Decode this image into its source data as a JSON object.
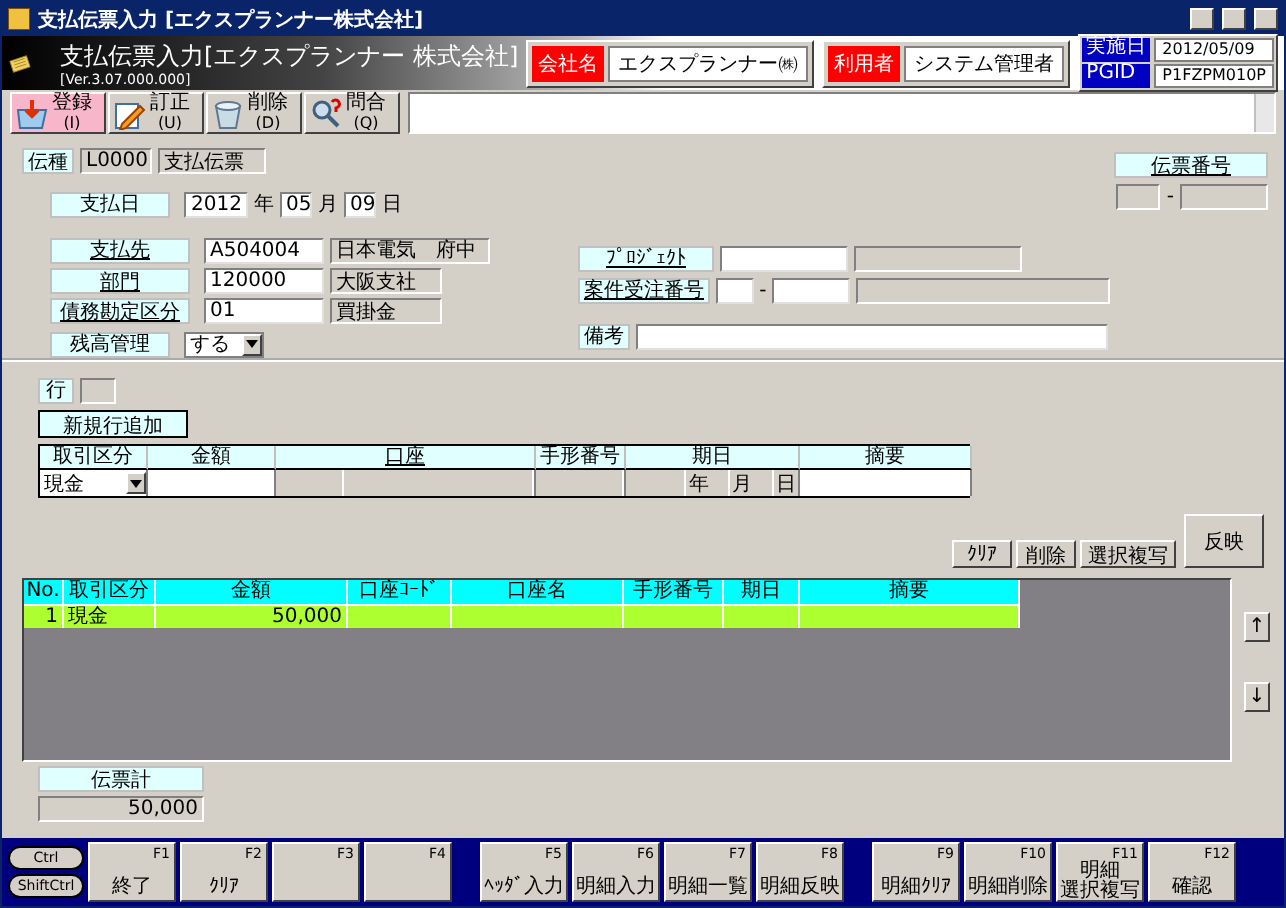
{
  "window": {
    "title": "支払伝票入力 [エクスプランナー株式会社]"
  },
  "header": {
    "title": "支払伝票入力[エクスプランナー 株式会社]",
    "version": "[Ver.3.07.000.000]",
    "company_label": "会社名",
    "company": "エクスプランナー㈱",
    "user_label": "利用者",
    "user": "システム管理者",
    "date_label": "実施日",
    "date": "2012/05/09",
    "pgid_label": "PGID",
    "pgid": "P1FZPM010P"
  },
  "toolbar": [
    {
      "kind": "register",
      "label": "登録",
      "key": "(I)",
      "selected": true
    },
    {
      "kind": "edit",
      "label": "訂正",
      "key": "(U)",
      "selected": false
    },
    {
      "kind": "delete",
      "label": "削除",
      "key": "(D)",
      "selected": false
    },
    {
      "kind": "inquiry",
      "label": "問合",
      "key": "(Q)",
      "selected": false
    }
  ],
  "form": {
    "slip_type": {
      "label": "伝種",
      "code": "L0000",
      "name": "支払伝票"
    },
    "slip_number": {
      "label": "伝票番号",
      "separator": "-"
    },
    "payment_date": {
      "label": "支払日",
      "year": "2012",
      "year_unit": "年",
      "month": "05",
      "month_unit": "月",
      "day": "09",
      "day_unit": "日"
    },
    "payee": {
      "label": "支払先",
      "code": "A504004",
      "name": "日本電気　府中"
    },
    "department": {
      "label": "部門",
      "code": "120000",
      "name": "大阪支社"
    },
    "debt_class": {
      "label": "債務勘定区分",
      "code": "01",
      "name": "買掛金"
    },
    "balance": {
      "label": "残高管理",
      "value": "する"
    },
    "project": {
      "label": "ﾌﾟﾛｼﾞｪｸﾄ"
    },
    "case_number": {
      "label": "案件受注番号",
      "separator": "-"
    },
    "remarks": {
      "label": "備考"
    }
  },
  "detail": {
    "row_label": "行",
    "add_button": "新規行追加",
    "columns": [
      "取引区分",
      "金額",
      "口座",
      "手形番号",
      "期日",
      "摘要"
    ],
    "entry": {
      "type": "現金",
      "year_unit": "年",
      "month_unit": "月",
      "day_unit": "日"
    },
    "buttons": [
      "ｸﾘｱ",
      "削除",
      "選択複写"
    ],
    "apply_button": "反映"
  },
  "grid": {
    "columns": [
      "No.",
      "取引区分",
      "金額",
      "口座ｺｰﾄﾞ",
      "口座名",
      "手形番号",
      "期日",
      "摘要"
    ],
    "rows": [
      {
        "no": "1",
        "type": "現金",
        "amount": "50,000",
        "selected": true
      }
    ],
    "up_button": "↑",
    "down_button": "↓"
  },
  "total": {
    "label": "伝票計",
    "value": "50,000"
  },
  "modifiers": [
    "Ctrl",
    "ShiftCtrl"
  ],
  "function_keys": [
    {
      "key": "F1",
      "lines": [
        "終了"
      ]
    },
    {
      "key": "F2",
      "lines": [
        "ｸﾘｱ"
      ]
    },
    {
      "key": "F3"
    },
    {
      "key": "F4"
    },
    {
      "key": "F5",
      "lines": [
        "ﾍｯﾀﾞ入力"
      ]
    },
    {
      "key": "F6",
      "lines": [
        "明細入力"
      ]
    },
    {
      "key": "F7",
      "lines": [
        "明細一覧"
      ]
    },
    {
      "key": "F8",
      "lines": [
        "明細反映"
      ]
    },
    {
      "key": "F9",
      "lines": [
        "明細ｸﾘｱ"
      ]
    },
    {
      "key": "F10",
      "lines": [
        "明細削除"
      ]
    },
    {
      "key": "F11",
      "lines": [
        "明細",
        "選択複写"
      ]
    },
    {
      "key": "F12",
      "lines": [
        "確認"
      ]
    }
  ]
}
